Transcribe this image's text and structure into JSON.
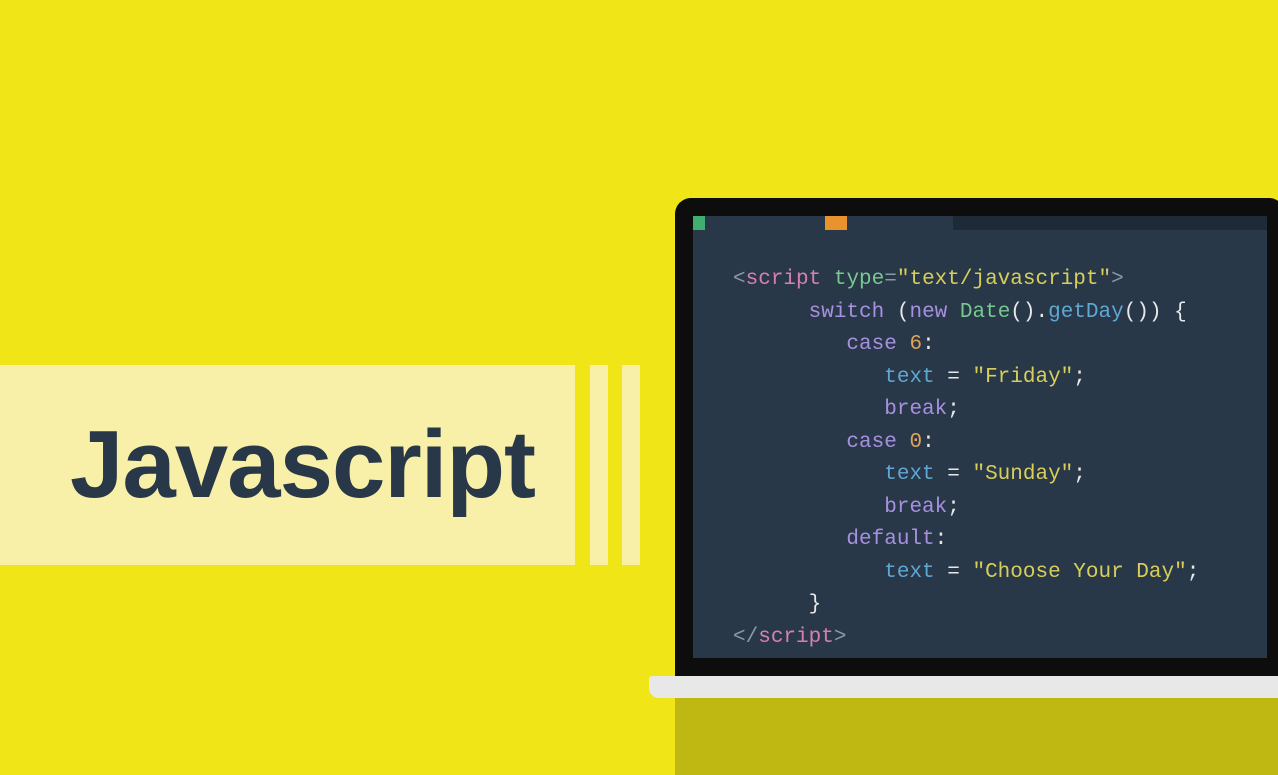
{
  "title": "Javascript",
  "colors": {
    "background": "#f0e517",
    "banner": "#f8f0a8",
    "title_text": "#283848",
    "screen_bg": "#283848",
    "laptop_frame": "#0d0d0d",
    "laptop_base": "#e8e8e8",
    "shadow": "#c0b812",
    "accent_green": "#3fae70",
    "accent_orange": "#e8932e"
  },
  "code": {
    "script_open_lt": "<",
    "script_tag": "script",
    "type_attr": " type",
    "eq": "=",
    "type_val": "\"text/javascript\"",
    "gt": ">",
    "switch_kw": "switch",
    "space": " ",
    "paren_open": "(",
    "new_kw": "new",
    "date_cls": " Date",
    "paren_close_dot": "().",
    "getday": "getDay",
    "paren_close2": "()) {",
    "case_kw": "case",
    "case6_val": " 6",
    "colon": ":",
    "text_id": "text",
    "assign": " = ",
    "friday": "\"Friday\"",
    "semi": ";",
    "break_kw": "break",
    "case0_val": " 0",
    "sunday": "\"Sunday\"",
    "default_kw": "default",
    "choose": "\"Choose Your Day\"",
    "brace_close": "}",
    "script_close_lt": "</",
    "script_close_gt": ">"
  }
}
